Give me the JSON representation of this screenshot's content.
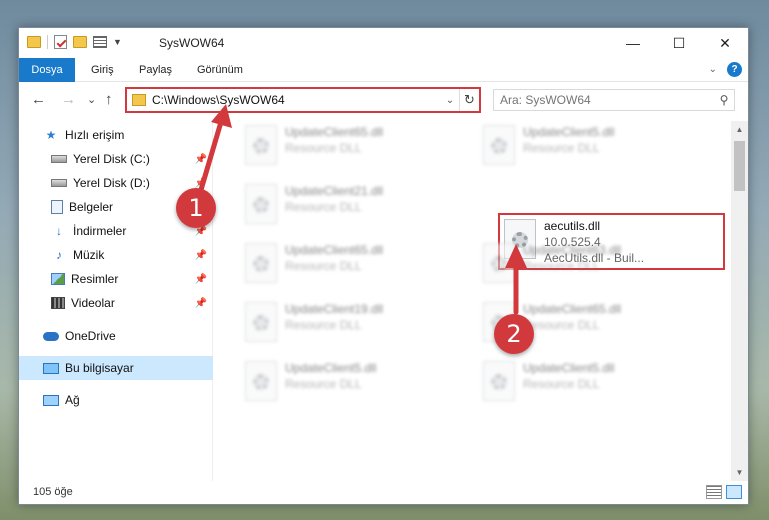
{
  "window": {
    "title": "SysWOW64",
    "controls": {
      "minimize": "—",
      "maximize": "☐",
      "close": "✕"
    }
  },
  "ribbon": {
    "file_tab": "Dosya",
    "tabs": [
      "Giriş",
      "Paylaş",
      "Görünüm"
    ],
    "help": "?"
  },
  "nav": {
    "back": "←",
    "forward": "→",
    "recent": "⌄",
    "up": "↑",
    "address": "C:\\Windows\\SysWOW64",
    "refresh": "↻",
    "search_placeholder": "Ara: SysWOW64"
  },
  "sidebar": {
    "items": [
      {
        "label": "Hızlı erişim",
        "icon": "star-icon",
        "pinned": false
      },
      {
        "label": "Yerel Disk (C:)",
        "icon": "drive-icon",
        "pinned": true
      },
      {
        "label": "Yerel Disk (D:)",
        "icon": "drive-icon",
        "pinned": true
      },
      {
        "label": "Belgeler",
        "icon": "documents-icon",
        "pinned": true
      },
      {
        "label": "İndirmeler",
        "icon": "download-icon",
        "pinned": true
      },
      {
        "label": "Müzik",
        "icon": "music-icon",
        "pinned": true
      },
      {
        "label": "Resimler",
        "icon": "pictures-icon",
        "pinned": true
      },
      {
        "label": "Videolar",
        "icon": "videos-icon",
        "pinned": true
      },
      {
        "label": "OneDrive",
        "icon": "cloud-icon",
        "pinned": false
      },
      {
        "label": "Bu bilgisayar",
        "icon": "computer-icon",
        "pinned": false,
        "selected": true
      },
      {
        "label": "Ağ",
        "icon": "network-icon",
        "pinned": false
      }
    ]
  },
  "files": [
    {
      "name": "UpdateClient65.dll",
      "type": "Resource DLL"
    },
    {
      "name": "UpdateClient5.dll",
      "type": "Resource DLL"
    },
    {
      "name": "UpdateClient21.dll",
      "type": "Resource DLL"
    },
    {
      "name": "aecutils.dll",
      "version": "10.0.525.4",
      "desc": "AecUtils.dll - Buil...",
      "highlighted": true
    },
    {
      "name": "UpdateClient65.dll",
      "type": "Resource DLL"
    },
    {
      "name": "UpdateClient63.dll",
      "type": "Resource DLL"
    },
    {
      "name": "UpdateClient19.dll",
      "type": "Resource DLL"
    },
    {
      "name": "UpdateClient65.dll",
      "type": "Resource DLL"
    },
    {
      "name": "UpdateClient5.dll",
      "type": "Resource DLL"
    },
    {
      "name": "UpdateClient5.dll",
      "type": "Resource DLL"
    }
  ],
  "status": {
    "count": "105 öğe"
  },
  "annotations": {
    "step1": "1",
    "step2": "2",
    "accent": "#d2393d"
  }
}
